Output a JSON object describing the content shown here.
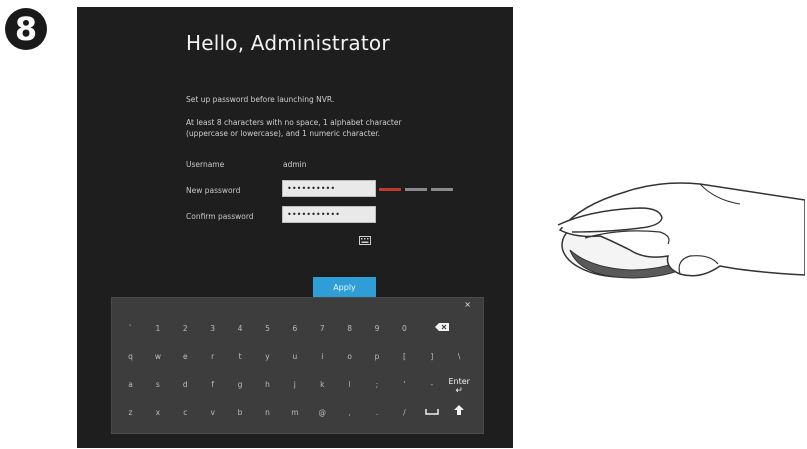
{
  "step": {
    "number": "8"
  },
  "screen": {
    "greeting": "Hello, Administrator",
    "info_line1": "Set up password before launching NVR.",
    "info_line2": "At least 8 characters with no space, 1 alphabet character (uppercase or lowercase), and 1 numeric character.",
    "username_label": "Username",
    "username_value": "admin",
    "new_password_label": "New password",
    "new_password_value": "••••••••••",
    "confirm_password_label": "Confirm password",
    "confirm_password_value": "•••••••••••",
    "apply_label": "Apply",
    "strength_colors": [
      "#c0392b",
      "#8a8a8a",
      "#8a8a8a"
    ]
  },
  "keyboard": {
    "close": "×",
    "rows": [
      [
        "`",
        "1",
        "2",
        "3",
        "4",
        "5",
        "6",
        "7",
        "8",
        "9",
        "0",
        "backspace-icon"
      ],
      [
        "q",
        "w",
        "e",
        "r",
        "t",
        "y",
        "u",
        "i",
        "o",
        "p",
        "[",
        "]",
        "\\"
      ],
      [
        "a",
        "s",
        "d",
        "f",
        "g",
        "h",
        "j",
        "k",
        "l",
        ";",
        "'",
        "-",
        "Enter"
      ],
      [
        "z",
        "x",
        "c",
        "v",
        "b",
        "n",
        "m",
        "@",
        ",",
        ".",
        "/",
        "space-icon",
        "shift-icon"
      ]
    ]
  },
  "colors": {
    "screen_bg": "#1e1e1e",
    "keyboard_bg": "#3d3d3d",
    "apply_button": "#2f9ed6"
  }
}
